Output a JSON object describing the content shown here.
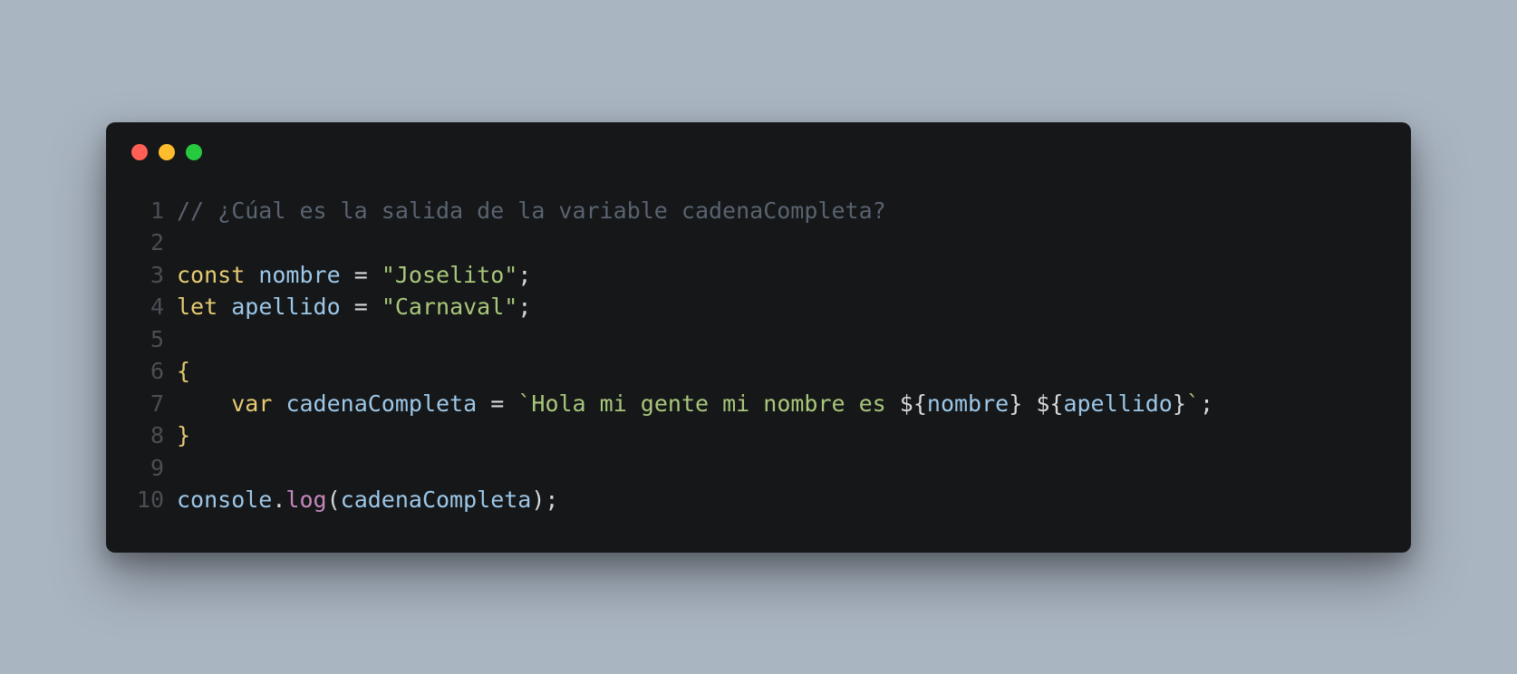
{
  "code": {
    "lines": [
      {
        "num": "1",
        "tokens": [
          {
            "cls": "tok-comment",
            "text": "// ¿Cúal es la salida de la variable cadenaCompleta?"
          }
        ]
      },
      {
        "num": "2",
        "tokens": []
      },
      {
        "num": "3",
        "tokens": [
          {
            "cls": "tok-keyword",
            "text": "const"
          },
          {
            "cls": "tok-punct",
            "text": " "
          },
          {
            "cls": "tok-variable",
            "text": "nombre"
          },
          {
            "cls": "tok-punct",
            "text": " "
          },
          {
            "cls": "tok-operator",
            "text": "="
          },
          {
            "cls": "tok-punct",
            "text": " "
          },
          {
            "cls": "tok-string",
            "text": "\"Joselito\""
          },
          {
            "cls": "tok-punct",
            "text": ";"
          }
        ]
      },
      {
        "num": "4",
        "tokens": [
          {
            "cls": "tok-keyword",
            "text": "let"
          },
          {
            "cls": "tok-punct",
            "text": " "
          },
          {
            "cls": "tok-variable",
            "text": "apellido"
          },
          {
            "cls": "tok-punct",
            "text": " "
          },
          {
            "cls": "tok-operator",
            "text": "="
          },
          {
            "cls": "tok-punct",
            "text": " "
          },
          {
            "cls": "tok-string",
            "text": "\"Carnaval\""
          },
          {
            "cls": "tok-punct",
            "text": ";"
          }
        ]
      },
      {
        "num": "5",
        "tokens": []
      },
      {
        "num": "6",
        "tokens": [
          {
            "cls": "tok-brace",
            "text": "{"
          }
        ]
      },
      {
        "num": "7",
        "tokens": [
          {
            "cls": "tok-punct",
            "text": "    "
          },
          {
            "cls": "tok-keyword",
            "text": "var"
          },
          {
            "cls": "tok-punct",
            "text": " "
          },
          {
            "cls": "tok-variable",
            "text": "cadenaCompleta"
          },
          {
            "cls": "tok-punct",
            "text": " "
          },
          {
            "cls": "tok-operator",
            "text": "="
          },
          {
            "cls": "tok-punct",
            "text": " "
          },
          {
            "cls": "tok-string",
            "text": "`Hola mi gente mi nombre es "
          },
          {
            "cls": "tok-templ-punct",
            "text": "${"
          },
          {
            "cls": "tok-templ-expr",
            "text": "nombre"
          },
          {
            "cls": "tok-templ-punct",
            "text": "}"
          },
          {
            "cls": "tok-string",
            "text": " "
          },
          {
            "cls": "tok-templ-punct",
            "text": "${"
          },
          {
            "cls": "tok-templ-expr",
            "text": "apellido"
          },
          {
            "cls": "tok-templ-punct",
            "text": "}"
          },
          {
            "cls": "tok-string",
            "text": "`"
          },
          {
            "cls": "tok-punct",
            "text": ";"
          }
        ]
      },
      {
        "num": "8",
        "tokens": [
          {
            "cls": "tok-brace",
            "text": "}"
          }
        ]
      },
      {
        "num": "9",
        "tokens": []
      },
      {
        "num": "10",
        "tokens": [
          {
            "cls": "tok-variable",
            "text": "console"
          },
          {
            "cls": "tok-punct",
            "text": "."
          },
          {
            "cls": "tok-method",
            "text": "log"
          },
          {
            "cls": "tok-punct",
            "text": "("
          },
          {
            "cls": "tok-variable",
            "text": "cadenaCompleta"
          },
          {
            "cls": "tok-punct",
            "text": ")"
          },
          {
            "cls": "tok-punct",
            "text": ";"
          }
        ]
      }
    ]
  }
}
